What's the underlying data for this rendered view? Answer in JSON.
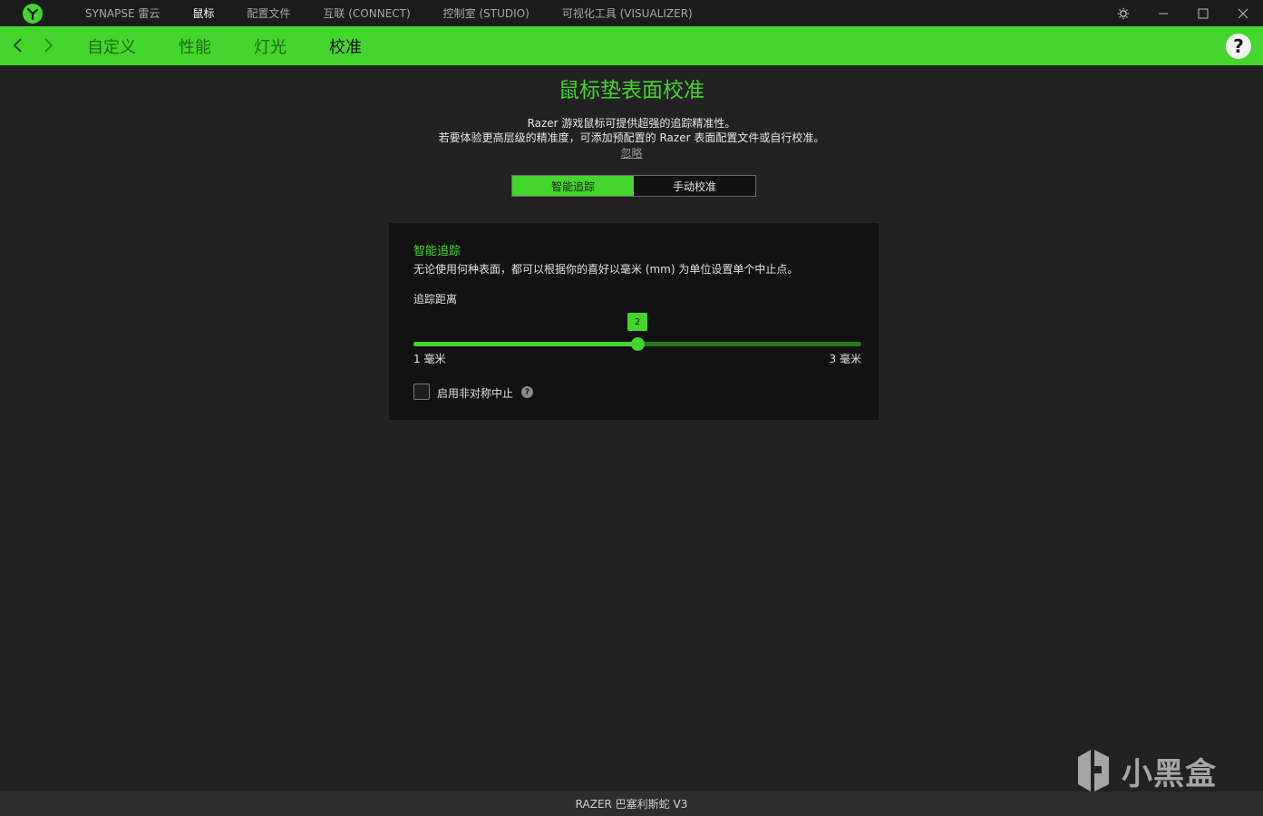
{
  "titlebar": {
    "tabs": [
      {
        "label": "SYNAPSE 雷云",
        "active": false
      },
      {
        "label": "鼠标",
        "active": true
      },
      {
        "label": "配置文件",
        "active": false
      },
      {
        "label": "互联 (CONNECT)",
        "active": false
      },
      {
        "label": "控制室 (STUDIO)",
        "active": false
      },
      {
        "label": "可视化工具 (VISUALIZER)",
        "active": false
      }
    ],
    "icons": [
      "settings-gear-icon",
      "minimize-icon",
      "maximize-icon",
      "close-icon"
    ]
  },
  "subnav": {
    "tabs": [
      {
        "label": "自定义",
        "active": false
      },
      {
        "label": "性能",
        "active": false
      },
      {
        "label": "灯光",
        "active": false
      },
      {
        "label": "校准",
        "active": true
      }
    ],
    "help_label": "?"
  },
  "main": {
    "title": "鼠标垫表面校准",
    "intro_line1": "Razer 游戏鼠标可提供超强的追踪精准性。",
    "intro_line2": "若要体验更高层级的精准度，可添加预配置的 Razer 表面配置文件或自行校准。",
    "ignore_link": "忽略",
    "mode_toggle": [
      {
        "label": "智能追踪",
        "active": true
      },
      {
        "label": "手动校准",
        "active": false
      }
    ]
  },
  "card": {
    "title": "智能追踪",
    "description": "无论使用何种表面，都可以根据你的喜好以毫米 (mm) 为单位设置单个中止点。",
    "distance_label": "追踪距离",
    "slider": {
      "min": 1,
      "max": 3,
      "value": 2,
      "value_label": "2",
      "min_label": "1 毫米",
      "max_label": "3 毫米"
    },
    "asym_checkbox": {
      "label": "启用非对称中止",
      "checked": false
    }
  },
  "footer": {
    "device": "RAZER 巴塞利斯蛇 V3"
  },
  "watermark": {
    "text": "小黑盒"
  },
  "colors": {
    "accent": "#44d62c",
    "background": "#222222",
    "card": "#121212",
    "titlebar": "#1b1b1b"
  }
}
